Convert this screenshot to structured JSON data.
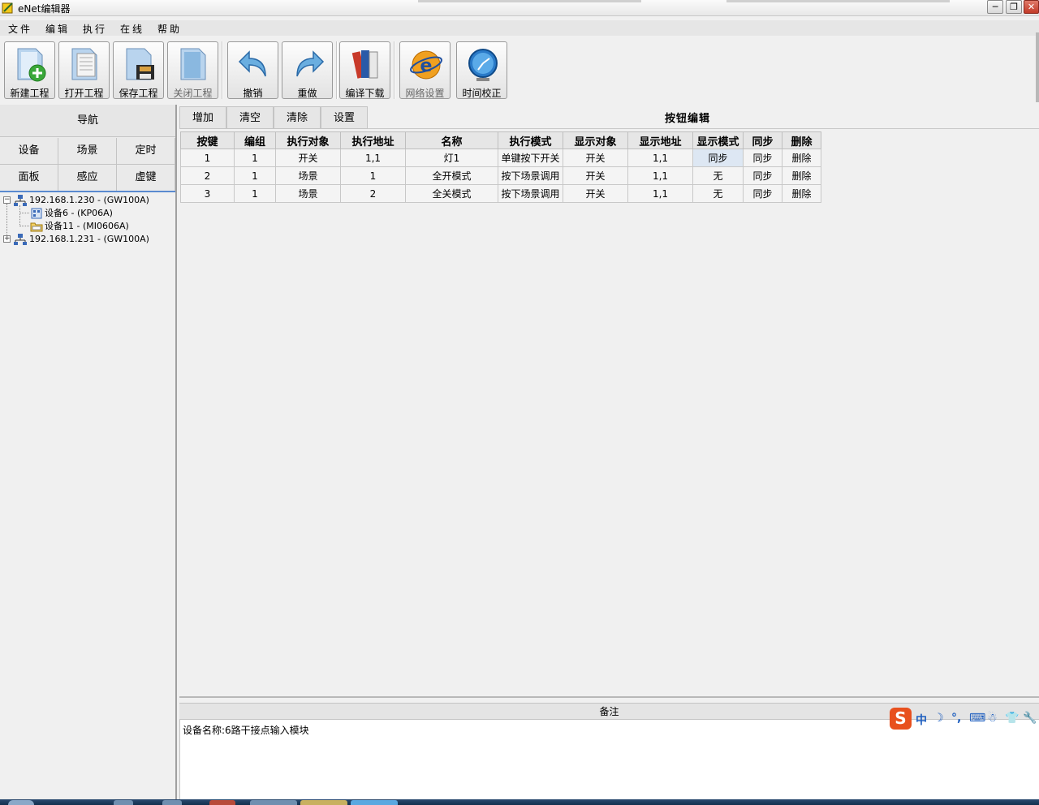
{
  "window": {
    "title": "eNet编辑器",
    "controls": {
      "minimize": "─",
      "maximize": "❐",
      "close": "✕"
    }
  },
  "menu": [
    "文件",
    "编辑",
    "执行",
    "在线",
    "帮助"
  ],
  "toolbar": {
    "buttons": [
      {
        "label": "新建工程",
        "icon": "new-project-icon",
        "enabled": true
      },
      {
        "label": "打开工程",
        "icon": "open-project-icon",
        "enabled": true
      },
      {
        "label": "保存工程",
        "icon": "save-project-icon",
        "enabled": true
      },
      {
        "label": "关闭工程",
        "icon": "close-project-icon",
        "enabled": false
      },
      {
        "label": "撤销",
        "icon": "undo-icon",
        "enabled": true
      },
      {
        "label": "重做",
        "icon": "redo-icon",
        "enabled": true
      },
      {
        "label": "编译下载",
        "icon": "compile-download-icon",
        "enabled": true
      },
      {
        "label": "网络设置",
        "icon": "network-settings-icon",
        "enabled": false
      },
      {
        "label": "时间校正",
        "icon": "time-sync-icon",
        "enabled": true
      }
    ]
  },
  "nav": {
    "title": "导航",
    "cells": [
      "设备",
      "场景",
      "定时",
      "面板",
      "感应",
      "虚键"
    ]
  },
  "tree": {
    "nodes": [
      {
        "label": "192.168.1.230 - (GW100A)",
        "expanded": true,
        "icon": "gateway-icon"
      },
      {
        "label": "设备6 - (KP06A)",
        "icon": "keypad-device-icon"
      },
      {
        "label": "设备11 - (MI0606A)",
        "icon": "input-module-icon"
      },
      {
        "label": "192.168.1.231 - (GW100A)",
        "expanded": false,
        "icon": "gateway-icon"
      }
    ]
  },
  "actions": [
    "增加",
    "清空",
    "清除",
    "设置"
  ],
  "editor_title": "按钮编辑",
  "table": {
    "columns": [
      "按键",
      "编组",
      "执行对象",
      "执行地址",
      "名称",
      "执行模式",
      "显示对象",
      "显示地址",
      "显示模式",
      "同步",
      "删除"
    ],
    "rows": [
      [
        "1",
        "1",
        "开关",
        "1,1",
        "灯1",
        "单键按下开关",
        "开关",
        "1,1",
        "同步",
        "同步",
        "删除"
      ],
      [
        "2",
        "1",
        "场景",
        "1",
        "全开模式",
        "按下场景调用",
        "开关",
        "1,1",
        "无",
        "同步",
        "删除"
      ],
      [
        "3",
        "1",
        "场景",
        "2",
        "全关模式",
        "按下场景调用",
        "开关",
        "1,1",
        "无",
        "同步",
        "删除"
      ]
    ]
  },
  "notes": {
    "title": "备注",
    "text": "设备名称:6路干接点输入模块"
  },
  "ime": {
    "logo": "S",
    "items": [
      "中",
      "☽",
      "°,",
      "⌨",
      "☃",
      "👕",
      "🔧"
    ]
  },
  "colors": {
    "selected_cell": "#dde7f3",
    "tree_accent": "#5a8ad0",
    "ime_brand": "#e8501e"
  }
}
